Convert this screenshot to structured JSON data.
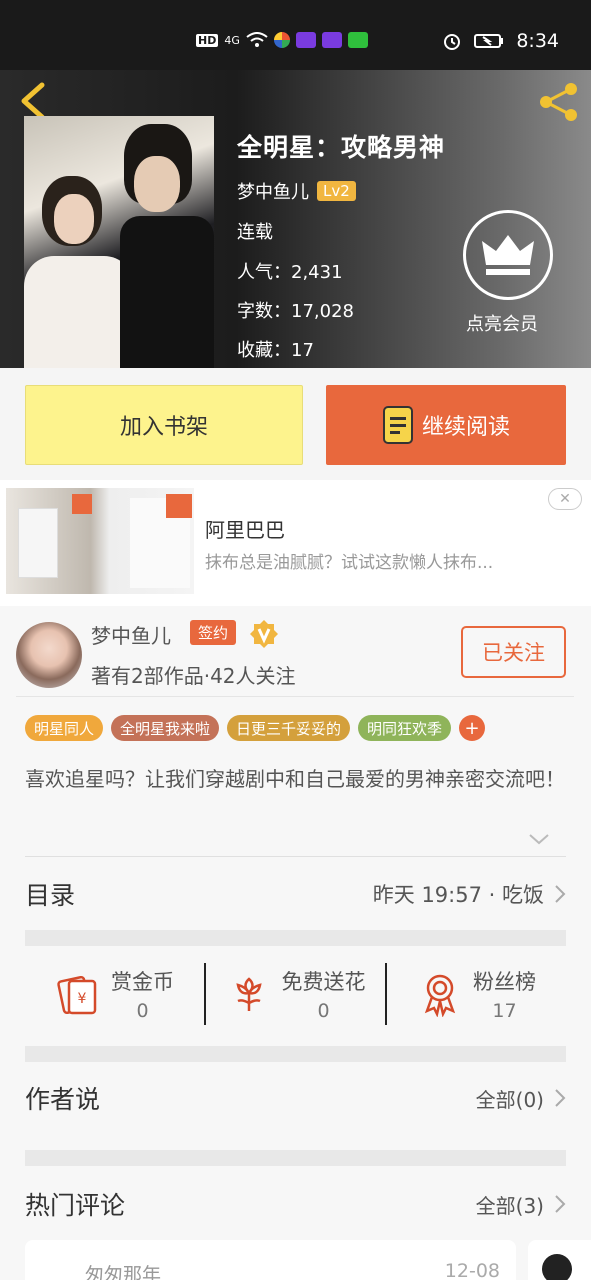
{
  "status_bar": {
    "time": "8:34",
    "indicators": [
      "HD",
      "4G"
    ]
  },
  "header": {
    "book_title": "全明星：攻略男神",
    "author": "梦中鱼儿",
    "level": "Lv2",
    "status": "连载",
    "popularity": "人气：2,431",
    "word_count": "字数：17,028",
    "favorites": "收藏：17",
    "vip_label": "点亮会员"
  },
  "actions": {
    "shelf_label": "加入书架",
    "read_label": "继续阅读"
  },
  "ad": {
    "title": "阿里巴巴",
    "desc": "抹布总是油腻腻？试试这款懒人抹布...",
    "close_label": "✕"
  },
  "author_profile": {
    "name": "梦中鱼儿",
    "sign_badge": "签约",
    "works": "著有2部作品·42人关注",
    "follow_label": "已关注"
  },
  "tags": [
    {
      "label": "明星同人",
      "color": "#f0a83c"
    },
    {
      "label": "全明星我来啦",
      "color": "#c47258"
    },
    {
      "label": "日更三千妥妥的",
      "color": "#d4a03c"
    },
    {
      "label": "明同狂欢季",
      "color": "#8fb45a"
    }
  ],
  "tag_more": "+",
  "description": "喜欢追星吗？让我们穿越剧中和自己最爱的男神亲密交流吧！",
  "catalog": {
    "title": "目录",
    "latest": "昨天 19:57 · 吃饭"
  },
  "stats": [
    {
      "label": "赏金币",
      "value": "0",
      "icon": "coin-envelope-icon"
    },
    {
      "label": "免费送花",
      "value": "0",
      "icon": "flower-icon"
    },
    {
      "label": "粉丝榜",
      "value": "17",
      "icon": "medal-icon"
    }
  ],
  "author_says": {
    "title": "作者说",
    "link": "全部(0)"
  },
  "hot_comments": {
    "title": "热门评论",
    "link": "全部(3)"
  },
  "comment": {
    "name": "匆匆那年",
    "date": "12-08"
  },
  "colors": {
    "accent": "#e8683d",
    "shelf_bg": "#fdf38d",
    "level": "#f1b640"
  }
}
